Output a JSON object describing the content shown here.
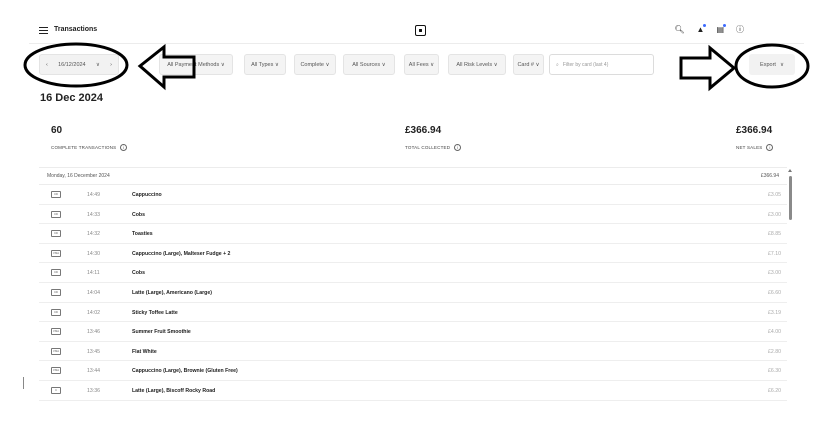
{
  "header": {
    "title": "Transactions",
    "icons": [
      "menu-icon",
      "square-logo-icon",
      "search-icon",
      "bell-icon",
      "clipboard-icon",
      "help-icon"
    ]
  },
  "filters": {
    "date": "16/12/2024",
    "chips": [
      "All Payment Methods",
      "All Types",
      "Complete",
      "All Sources",
      "All Fees",
      "All Risk Levels",
      "Card #"
    ],
    "search_placeholder": "Filter by card (last 4)",
    "export_label": "Export"
  },
  "summary": {
    "date_heading": "16 Dec 2024",
    "stats": [
      {
        "value": "60",
        "label": "COMPLETE TRANSACTIONS"
      },
      {
        "value": "£366.94",
        "label": "TOTAL COLLECTED"
      },
      {
        "value": "£366.94",
        "label": "NET SALES"
      }
    ]
  },
  "list": {
    "day_label": "Monday, 16 December 2024",
    "day_total": "£366.94",
    "rows": [
      {
        "badge": "CD",
        "time": "14:49",
        "desc": "Cappuccino",
        "amount": "£3.05"
      },
      {
        "badge": "CD",
        "time": "14:33",
        "desc": "Cobs",
        "amount": "£3.00"
      },
      {
        "badge": "CD",
        "time": "14:32",
        "desc": "Toasties",
        "amount": "£8.85"
      },
      {
        "badge": "VISA",
        "time": "14:30",
        "desc": "Cappuccino (Large), Malteser Fudge + 2",
        "amount": "£7.10"
      },
      {
        "badge": "CD",
        "time": "14:11",
        "desc": "Cobs",
        "amount": "£3.00"
      },
      {
        "badge": "CD",
        "time": "14:04",
        "desc": "Latte (Large), Americano (Large)",
        "amount": "£6.60"
      },
      {
        "badge": "CD",
        "time": "14:02",
        "desc": "Sticky Toffee Latte",
        "amount": "£3.19"
      },
      {
        "badge": "VISA",
        "time": "13:46",
        "desc": "Summer Fruit Smoothie",
        "amount": "£4.00"
      },
      {
        "badge": "VISA",
        "time": "13:45",
        "desc": "Flat White",
        "amount": "£2.80"
      },
      {
        "badge": "VISA",
        "time": "13:44",
        "desc": "Cappuccino (Large), Brownie (Gluten Free)",
        "amount": "£6.30"
      },
      {
        "badge": "C",
        "time": "13:36",
        "desc": "Latte (Large), Biscoff Rocky Road",
        "amount": "£6.20"
      }
    ]
  },
  "colors": {
    "notification_dot": "#3d6bff",
    "annotation": "#000000"
  }
}
